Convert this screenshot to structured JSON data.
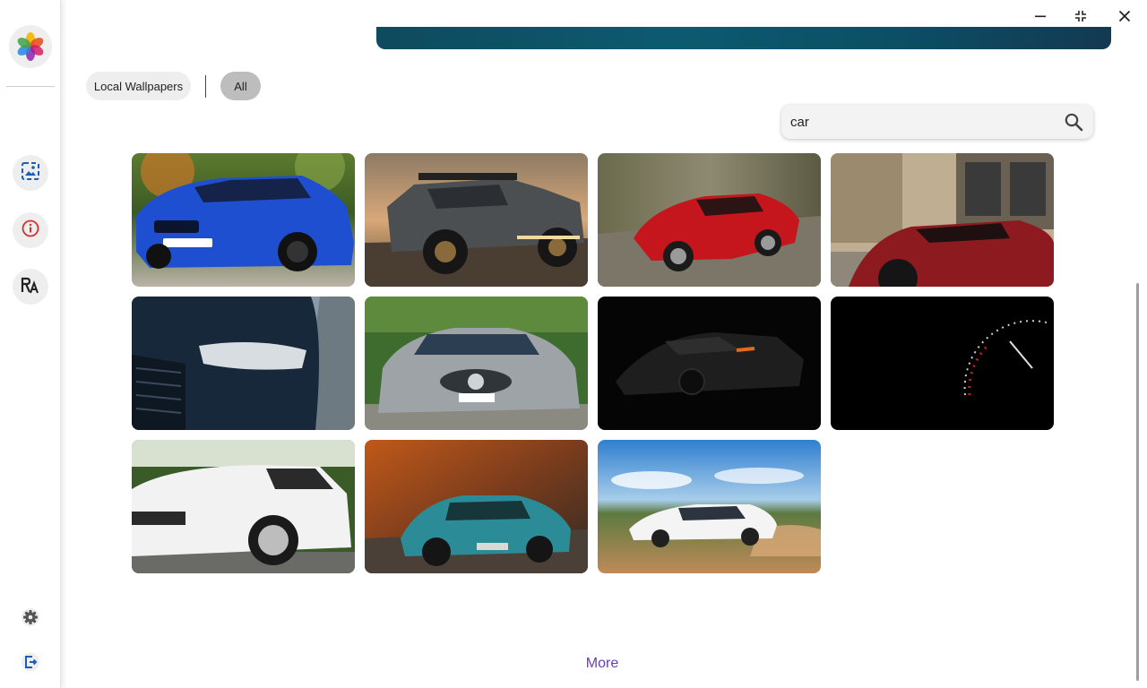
{
  "window_controls": {
    "minimize_icon": "minimize-icon",
    "restore_icon": "restore-icon",
    "close_icon": "close-icon"
  },
  "sidebar": {
    "logo_icon": "flower-logo-icon",
    "items": [
      {
        "name": "wallpapers",
        "icon": "wallpaper-gallery-icon"
      },
      {
        "name": "info",
        "icon": "info-icon"
      },
      {
        "name": "fonts",
        "icon": "font-icon"
      }
    ],
    "bottom": [
      {
        "name": "settings",
        "icon": "gear-icon"
      },
      {
        "name": "exit",
        "icon": "logout-icon"
      }
    ],
    "accent": "#1a5fb4"
  },
  "filters": {
    "local_wallpapers": "Local Wallpapers",
    "all": "All",
    "active": "All"
  },
  "search": {
    "value": "car",
    "icon": "search-icon"
  },
  "wallpapers": [
    {
      "subject": "blue sedan"
    },
    {
      "subject": "off-road pickup truck"
    },
    {
      "subject": "red sports car"
    },
    {
      "subject": "red supercar on street"
    },
    {
      "subject": "dark sedan headlight"
    },
    {
      "subject": "silver coupe"
    },
    {
      "subject": "black sports car in dark"
    },
    {
      "subject": "speedometer"
    },
    {
      "subject": "white SUV"
    },
    {
      "subject": "teal classic coupe"
    },
    {
      "subject": "white sedan drifting"
    }
  ],
  "more": {
    "label": "More",
    "color": "#6a3db8"
  }
}
